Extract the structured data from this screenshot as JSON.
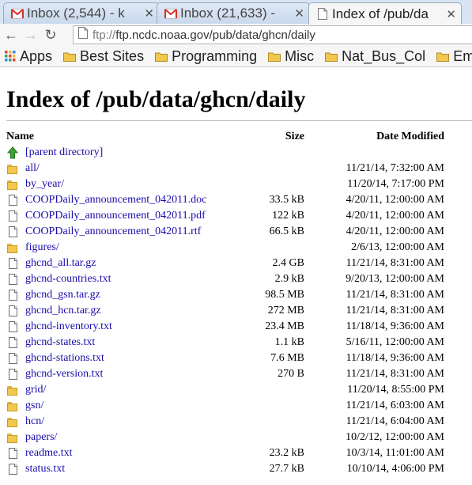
{
  "tabs": [
    {
      "title": "Inbox (2,544) - k",
      "icon": "gmail-icon"
    },
    {
      "title": "Inbox (21,633) -",
      "icon": "gmail-icon"
    },
    {
      "title": "Index of /pub/da",
      "icon": "page-icon",
      "active": true
    }
  ],
  "toolbar": {
    "url_scheme": "ftp://",
    "url_rest": "ftp.ncdc.noaa.gov/pub/data/ghcn/daily"
  },
  "bookmarks": [
    {
      "label": "Apps",
      "icon": "apps-grid-icon"
    },
    {
      "label": "Best Sites",
      "icon": "folder-icon"
    },
    {
      "label": "Programming",
      "icon": "folder-icon"
    },
    {
      "label": "Misc",
      "icon": "folder-icon"
    },
    {
      "label": "Nat_Bus_Col",
      "icon": "folder-icon"
    },
    {
      "label": "Em",
      "icon": "folder-icon"
    }
  ],
  "page": {
    "heading": "Index of /pub/data/ghcn/daily",
    "columns": {
      "name": "Name",
      "size": "Size",
      "date": "Date Modified"
    },
    "parent": "[parent directory]",
    "entries": [
      {
        "name": "all/",
        "type": "folder",
        "size": "",
        "date": "11/21/14, 7:32:00 AM"
      },
      {
        "name": "by_year/",
        "type": "folder",
        "size": "",
        "date": "11/20/14, 7:17:00 PM"
      },
      {
        "name": "COOPDaily_announcement_042011.doc",
        "type": "file",
        "size": "33.5 kB",
        "date": "4/20/11, 12:00:00 AM"
      },
      {
        "name": "COOPDaily_announcement_042011.pdf",
        "type": "file",
        "size": "122 kB",
        "date": "4/20/11, 12:00:00 AM"
      },
      {
        "name": "COOPDaily_announcement_042011.rtf",
        "type": "file",
        "size": "66.5 kB",
        "date": "4/20/11, 12:00:00 AM"
      },
      {
        "name": "figures/",
        "type": "folder",
        "size": "",
        "date": "2/6/13, 12:00:00 AM"
      },
      {
        "name": "ghcnd_all.tar.gz",
        "type": "file",
        "size": "2.4 GB",
        "date": "11/21/14, 8:31:00 AM"
      },
      {
        "name": "ghcnd-countries.txt",
        "type": "file",
        "size": "2.9 kB",
        "date": "9/20/13, 12:00:00 AM"
      },
      {
        "name": "ghcnd_gsn.tar.gz",
        "type": "file",
        "size": "98.5 MB",
        "date": "11/21/14, 8:31:00 AM"
      },
      {
        "name": "ghcnd_hcn.tar.gz",
        "type": "file",
        "size": "272 MB",
        "date": "11/21/14, 8:31:00 AM"
      },
      {
        "name": "ghcnd-inventory.txt",
        "type": "file",
        "size": "23.4 MB",
        "date": "11/18/14, 9:36:00 AM"
      },
      {
        "name": "ghcnd-states.txt",
        "type": "file",
        "size": "1.1 kB",
        "date": "5/16/11, 12:00:00 AM"
      },
      {
        "name": "ghcnd-stations.txt",
        "type": "file",
        "size": "7.6 MB",
        "date": "11/18/14, 9:36:00 AM"
      },
      {
        "name": "ghcnd-version.txt",
        "type": "file",
        "size": "270 B",
        "date": "11/21/14, 8:31:00 AM"
      },
      {
        "name": "grid/",
        "type": "folder",
        "size": "",
        "date": "11/20/14, 8:55:00 PM"
      },
      {
        "name": "gsn/",
        "type": "folder",
        "size": "",
        "date": "11/21/14, 6:03:00 AM"
      },
      {
        "name": "hcn/",
        "type": "folder",
        "size": "",
        "date": "11/21/14, 6:04:00 AM"
      },
      {
        "name": "papers/",
        "type": "folder",
        "size": "",
        "date": "10/2/12, 12:00:00 AM"
      },
      {
        "name": "readme.txt",
        "type": "file",
        "size": "23.2 kB",
        "date": "10/3/14, 11:01:00 AM"
      },
      {
        "name": "status.txt",
        "type": "file",
        "size": "27.7 kB",
        "date": "10/10/14, 4:06:00 PM"
      }
    ]
  },
  "colors": {
    "link": "#1a0dab",
    "tabstrip": "#d7e4f3",
    "gmail_red": "#d93025"
  }
}
